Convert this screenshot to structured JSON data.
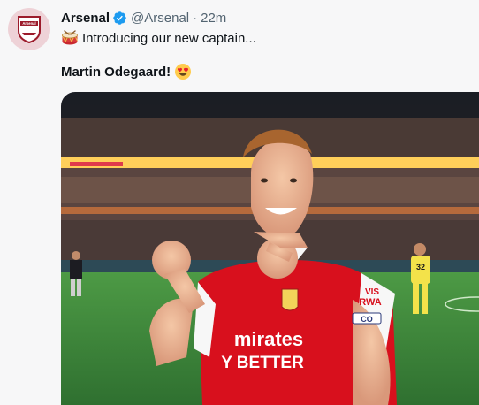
{
  "tweet": {
    "author_name": "Arsenal",
    "handle": "@Arsenal",
    "separator": "·",
    "time": "22m",
    "line1": "Introducing our new captain...",
    "line2": "Martin Odegaard!",
    "avatar_text": "Arsenal",
    "line1_emoji": "drum-emoji",
    "line2_emoji": "heart-eyes-emoji",
    "verified_icon": "verified-badge-icon"
  },
  "photo": {
    "shirt_sponsor_line1": "mirates",
    "shirt_sponsor_line2": "Y BETTER",
    "sleeve_text_1": "VIS",
    "sleeve_text_2": "RWA",
    "sleeve_text_3": "CO",
    "background_player_number": "32"
  },
  "colors": {
    "verified": "#1d9bf0",
    "text_primary": "#0f1419",
    "text_secondary": "#536471",
    "arsenal_red": "#db0007",
    "avatar_bg": "#eed2d7",
    "pitch_green": "#3f8a3b"
  }
}
